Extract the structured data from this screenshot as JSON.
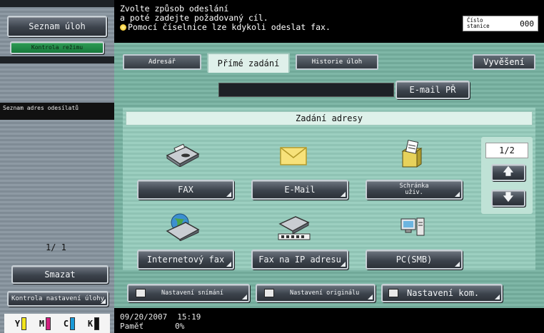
{
  "left_panel": {
    "task_list_button": "Seznam úloh",
    "mode_check_button": "Kontrola režimu",
    "sender_list_label": "Seznam adres odesílatů",
    "page_counter": "1/ 1",
    "delete_button": "Smazat",
    "job_settings_button": "Kontrola nastavení úlohy",
    "toner_colors": [
      {
        "label": "Y",
        "color": "#f2e41c"
      },
      {
        "label": "M",
        "color": "#d3207f"
      },
      {
        "label": "C",
        "color": "#1a9ad7"
      },
      {
        "label": "K",
        "color": "#111111"
      }
    ]
  },
  "message": {
    "line1": "Zvolte způsob odeslání",
    "line2": "a poté zadejte požadovaný cíl.",
    "line3": "Pomocí číselnice lze kdykoli odeslat fax.",
    "station_label": "Číslo stanice",
    "station_value": "000"
  },
  "tabs": {
    "address_book": "Adresář",
    "direct_input": "Přímé zadání",
    "job_history": "Historie úloh",
    "release": "Vyvěšení"
  },
  "email_field": {
    "value": "",
    "button": "E-mail PŘ"
  },
  "address_panel": {
    "title": "Zadání adresy",
    "items": [
      {
        "label": "FAX",
        "icon": "fax-icon"
      },
      {
        "label": "E-Mail",
        "icon": "envelope-icon"
      },
      {
        "label": "Schránka uživ.",
        "icon": "box-icon"
      },
      {
        "label": "Internetový fax",
        "icon": "internet-fax-icon"
      },
      {
        "label": "Fax na IP adresu",
        "icon": "ip-fax-icon"
      },
      {
        "label": "PC(SMB)",
        "icon": "computer-icon"
      }
    ],
    "page_indicator": "1/2"
  },
  "bottom_buttons": {
    "scan_settings": "Nastavení snímání",
    "original_settings": "Nastavení originálu",
    "comm_settings": "Nastavení kom."
  },
  "status_bar": {
    "date": "09/20/2007",
    "time": "15:19",
    "memory_label": "Paměť",
    "memory_value": "0%"
  }
}
